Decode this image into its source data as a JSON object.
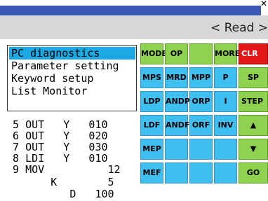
{
  "titlebar": {
    "close_glyph": "✕"
  },
  "status": {
    "mode_text": "< Read >"
  },
  "popup_menu": {
    "items": [
      {
        "label": "PC diagnostics",
        "selected": true
      },
      {
        "label": "Parameter setting",
        "selected": false
      },
      {
        "label": "Keyword setup",
        "selected": false
      },
      {
        "label": "List Monitor",
        "selected": false
      }
    ]
  },
  "program": {
    "lines": [
      "  5 OUT   Y   010",
      "  6 OUT   Y   020",
      "  7 OUT   Y   030",
      "  8 LDI   Y   010",
      "  9 MOV          12",
      "        K        5",
      "           D   100"
    ]
  },
  "keypad": {
    "rows": [
      [
        {
          "label": "MODE",
          "color": "green"
        },
        {
          "label": "OP",
          "color": "green"
        },
        {
          "label": "",
          "color": "green"
        },
        {
          "label": "MORE",
          "color": "green"
        },
        {
          "label": "CLR",
          "color": "red"
        }
      ],
      [
        {
          "label": "MPS",
          "color": "blue"
        },
        {
          "label": "MRD",
          "color": "blue"
        },
        {
          "label": "MPP",
          "color": "blue"
        },
        {
          "label": "P",
          "color": "blue"
        },
        {
          "label": "SP",
          "color": "green"
        }
      ],
      [
        {
          "label": "LDP",
          "color": "blue"
        },
        {
          "label": "ANDP",
          "color": "blue"
        },
        {
          "label": "ORP",
          "color": "blue"
        },
        {
          "label": "I",
          "color": "blue"
        },
        {
          "label": "STEP",
          "color": "green"
        }
      ],
      [
        {
          "label": "LDF",
          "color": "blue"
        },
        {
          "label": "ANDF",
          "color": "blue"
        },
        {
          "label": "ORF",
          "color": "blue"
        },
        {
          "label": "INV",
          "color": "blue"
        },
        {
          "label": "▲",
          "color": "green"
        }
      ],
      [
        {
          "label": "MEP",
          "color": "blue"
        },
        {
          "label": "",
          "color": "blue"
        },
        {
          "label": "",
          "color": "blue"
        },
        {
          "label": "",
          "color": "blue"
        },
        {
          "label": "▼",
          "color": "green"
        }
      ],
      [
        {
          "label": "MEF",
          "color": "blue"
        },
        {
          "label": "",
          "color": "blue"
        },
        {
          "label": "",
          "color": "blue"
        },
        {
          "label": "",
          "color": "blue"
        },
        {
          "label": "GO",
          "color": "green"
        }
      ]
    ]
  },
  "colors": {
    "title_blue": "#3b59b4",
    "key_blue": "#3fbfef",
    "key_green": "#8ed24f",
    "key_red": "#e21818",
    "menu_highlight": "#1aa9e2"
  }
}
